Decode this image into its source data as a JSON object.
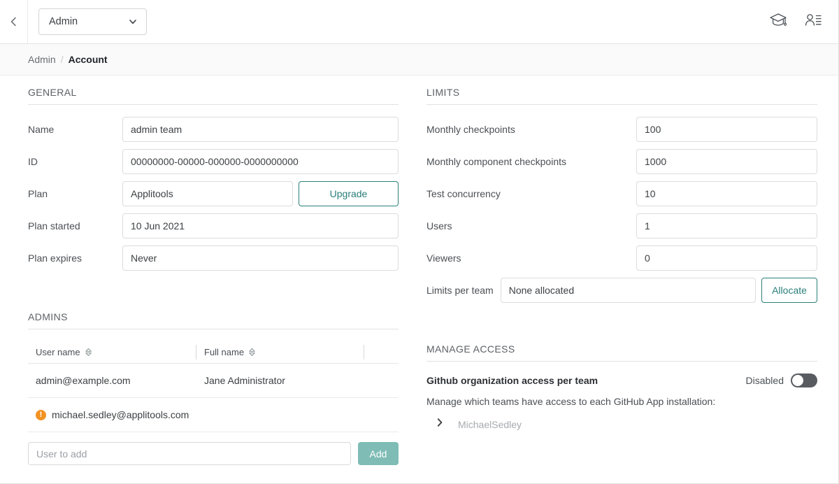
{
  "topbar": {
    "back_icon": "chevron-left-icon",
    "team_selector_value": "Admin",
    "team_selector_icon": "chevron-down-icon",
    "academy_icon": "graduation-cap-icon",
    "account_icon": "user-details-icon"
  },
  "breadcrumb": {
    "parent": "Admin",
    "separator": "/",
    "current": "Account"
  },
  "general": {
    "title": "GENERAL",
    "fields": [
      {
        "label": "Name",
        "value": "admin team"
      },
      {
        "label": "ID",
        "value": "00000000-00000-000000-0000000000"
      },
      {
        "label": "Plan",
        "value": "Applitools"
      },
      {
        "label": "Plan started",
        "value": "10 Jun 2021"
      },
      {
        "label": "Plan expires",
        "value": "Never"
      }
    ],
    "upgrade_label": "Upgrade"
  },
  "limits": {
    "title": "LIMITS",
    "fields": [
      {
        "label": "Monthly checkpoints",
        "value": "100"
      },
      {
        "label": "Monthly component checkpoints",
        "value": "1000"
      },
      {
        "label": "Test concurrency",
        "value": "10"
      },
      {
        "label": "Users",
        "value": "1"
      },
      {
        "label": "Viewers",
        "value": "0"
      }
    ],
    "limits_per_team_label": "Limits per team",
    "limits_per_team_value": "None allocated",
    "allocate_label": "Allocate"
  },
  "admins": {
    "title": "ADMINS",
    "columns": [
      {
        "label": "User name",
        "sort_icon": "sort-icon"
      },
      {
        "label": "Full name",
        "sort_icon": "sort-icon"
      },
      {
        "label": ""
      }
    ],
    "rows": [
      {
        "user_name": "admin@example.com",
        "full_name": "Jane Administrator",
        "warning": false
      },
      {
        "user_name": "michael.sedley@applitools.com",
        "full_name": "",
        "warning": true,
        "warning_icon": "warning-icon",
        "warning_glyph": "!"
      }
    ],
    "add_placeholder": "User to add",
    "add_value": "",
    "add_button_label": "Add"
  },
  "manage_access": {
    "title": "MANAGE ACCESS",
    "feature_title": "Github organization access per team",
    "toggle_state_label": "Disabled",
    "toggle_on": false,
    "description": "Manage which teams have access to each GitHub App installation:",
    "orgs": [
      {
        "name": "MichaelSedley",
        "expand_icon": "chevron-right-icon"
      }
    ]
  },
  "colors": {
    "accent_teal": "#2a7f7b",
    "add_button": "#7fbcb5",
    "warning_orange": "#f29222",
    "toggle_off": "#585c60",
    "text": "#3c4043"
  }
}
